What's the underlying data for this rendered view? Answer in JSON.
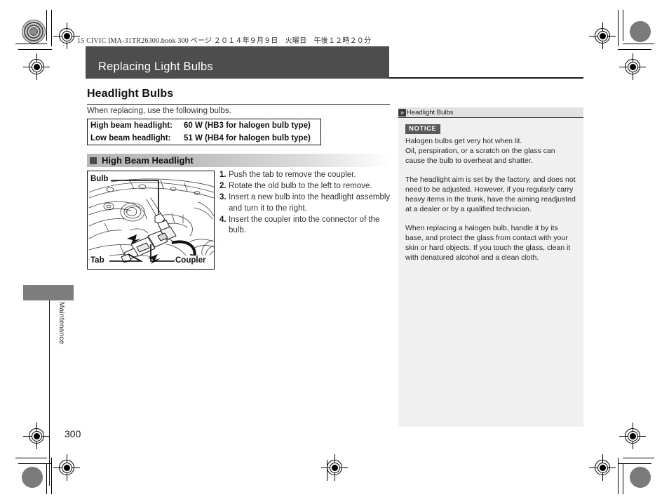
{
  "running_head": "15 CIVIC IMA-31TR26300.book  300 ページ  ２０１４年９月９日　火曜日　午後１２時２０分",
  "chapter": {
    "title": "Replacing Light Bulbs"
  },
  "main": {
    "heading": "Headlight Bulbs",
    "intro": "When replacing, use the following bulbs.",
    "spec_table": {
      "rows": [
        {
          "label": "High beam headlight:",
          "value": "60 W (HB3 for halogen bulb type)"
        },
        {
          "label": "Low beam headlight:",
          "value": "51 W (HB4 for halogen bulb type)"
        }
      ]
    },
    "section_title": "High Beam Headlight",
    "figure": {
      "labels": {
        "bulb": "Bulb",
        "tab": "Tab",
        "coupler": "Coupler"
      }
    },
    "steps": [
      {
        "num": "1.",
        "text": "Push the tab to remove the coupler."
      },
      {
        "num": "2.",
        "text": "Rotate the old bulb to the left to remove."
      },
      {
        "num": "3.",
        "text": "Insert a new bulb into the headlight assembly and turn it to the right."
      },
      {
        "num": "4.",
        "text": "Insert the coupler into the connector of the bulb."
      }
    ]
  },
  "sidebar": {
    "header_icon": "double-chevron-right-icon",
    "header_title": "Headlight Bulbs",
    "notice_label": "NOTICE",
    "paragraphs": [
      "Halogen bulbs get very hot when lit.\nOil, perspiration, or a scratch on the glass can cause the bulb to overheat and shatter.",
      "The headlight aim is set by the factory, and does not need to be adjusted. However, if you regularly carry heavy items in the trunk, have the aiming readjusted at a dealer or by a qualified technician.",
      "When replacing a halogen bulb, handle it by its base, and protect the glass from contact with your skin or hard objects. If you touch the glass, clean it with denatured alcohol and a clean cloth."
    ]
  },
  "margin": {
    "chapter_tab": "Maintenance"
  },
  "page_number": "300",
  "colors": {
    "title_bar": "#4d4d4d",
    "sidebar_panel": "#f0f0f0",
    "notice_badge": "#595959",
    "tab_block": "#7d7d7d"
  }
}
